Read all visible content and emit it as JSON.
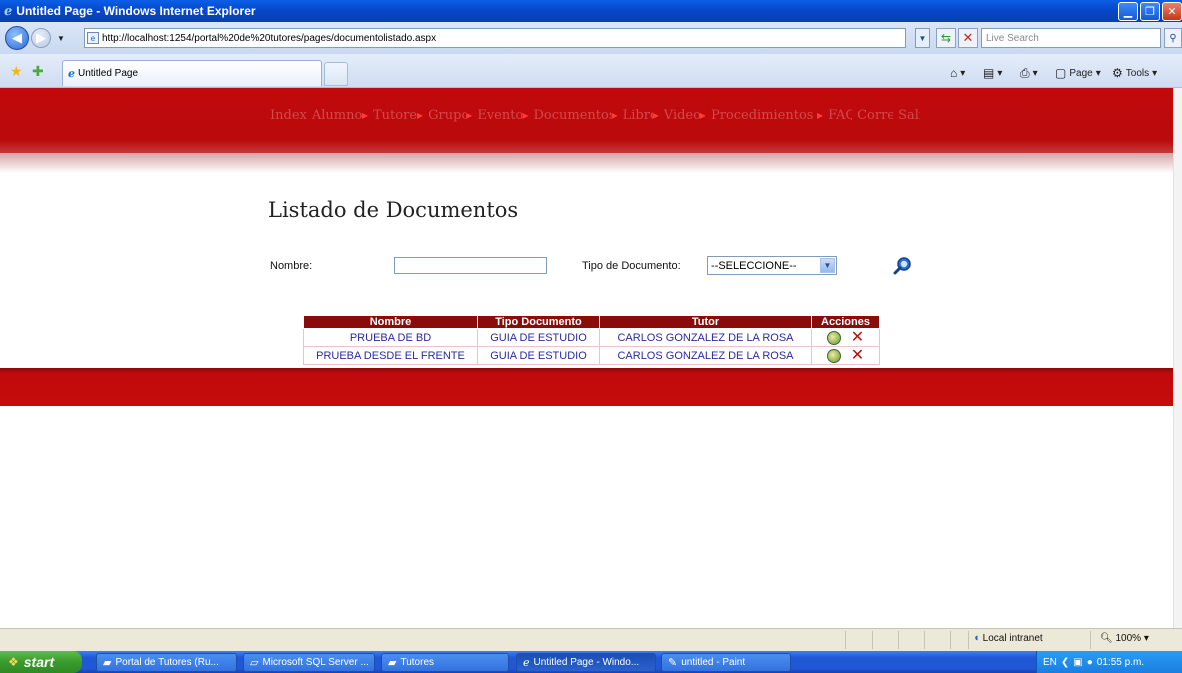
{
  "window": {
    "title": "Untitled Page - Windows Internet Explorer"
  },
  "address": {
    "url": "http://localhost:1254/portal%20de%20tutores/pages/documentolistado.aspx",
    "search_placeholder": "Live Search"
  },
  "tab": {
    "label": "Untitled Page"
  },
  "commands": {
    "page_label": "Page",
    "tools_label": "Tools"
  },
  "menu": [
    {
      "label": "Index",
      "arrow": false
    },
    {
      "label": "Alumnos",
      "arrow": true
    },
    {
      "label": "Tutores",
      "arrow": true
    },
    {
      "label": "Grupos",
      "arrow": true
    },
    {
      "label": "Eventos",
      "arrow": true
    },
    {
      "label": "Documentos",
      "arrow": true
    },
    {
      "label": "Libros",
      "arrow": true
    },
    {
      "label": "Videos",
      "arrow": true
    },
    {
      "label": "Procedimientos",
      "arrow": true
    },
    {
      "label": "FAQ",
      "arrow": false
    },
    {
      "label": "Correo",
      "arrow": false
    },
    {
      "label": "Salir",
      "arrow": false
    }
  ],
  "page": {
    "title": "Listado de Documentos",
    "nombre_label": "Nombre:",
    "nombre_value": "",
    "tipo_label": "Tipo de Documento:",
    "tipo_selected": "--SELECCIONE--"
  },
  "table": {
    "headers": [
      "Nombre",
      "Tipo Documento",
      "Tutor",
      "Acciones"
    ],
    "rows": [
      {
        "nombre": "PRUEBA DE BD",
        "tipo": "GUIA DE ESTUDIO",
        "tutor": "CARLOS GONZALEZ DE LA ROSA"
      },
      {
        "nombre": "PRUEBA DESDE EL FRENTE",
        "tipo": "GUIA DE ESTUDIO",
        "tutor": "CARLOS GONZALEZ DE LA ROSA"
      }
    ]
  },
  "status": {
    "zone": "Local intranet",
    "zoom": "100%"
  },
  "taskbar": {
    "start_label": "start",
    "tasks": [
      {
        "label": "Portal de Tutores (Ru...",
        "icon": "folder-icon",
        "active": false
      },
      {
        "label": "Microsoft SQL Server ...",
        "icon": "sql-server-icon",
        "active": false
      },
      {
        "label": "Tutores",
        "icon": "folder-icon",
        "active": false
      },
      {
        "label": "Untitled Page - Windo...",
        "icon": "ie-icon",
        "active": true
      },
      {
        "label": "untitled - Paint",
        "icon": "paint-icon",
        "active": false
      }
    ],
    "tray": {
      "language": "EN",
      "time": "01:55 p.m."
    }
  },
  "colors": {
    "header_red": "#c2090b",
    "table_header": "#8b0a0a",
    "link_blue": "#2a2aa0"
  }
}
